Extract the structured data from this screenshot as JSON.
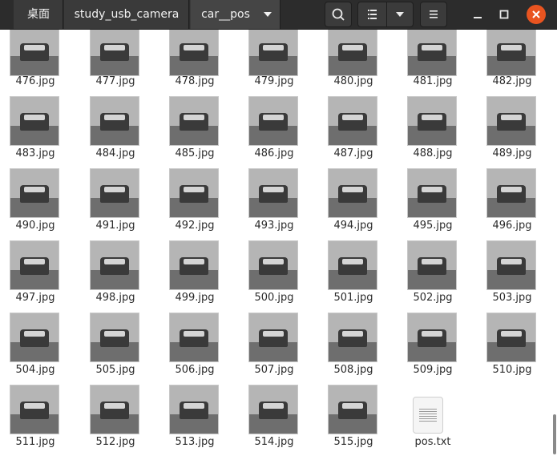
{
  "titlebar": {
    "breadcrumbs": [
      {
        "label": "桌面"
      },
      {
        "label": "study_usb_camera"
      },
      {
        "label": "car__pos"
      }
    ],
    "icons": {
      "search": "search-icon",
      "list_view": "list-view-icon",
      "view_dropdown": "chevron-down-icon",
      "menu": "hamburger-menu-icon",
      "minimize": "minimize-icon",
      "maximize": "maximize-icon",
      "close": "close-icon"
    },
    "colors": {
      "close": "#e95420",
      "bar": "#2c2c2c"
    }
  },
  "files": [
    "476.jpg",
    "477.jpg",
    "478.jpg",
    "479.jpg",
    "480.jpg",
    "481.jpg",
    "482.jpg",
    "483.jpg",
    "484.jpg",
    "485.jpg",
    "486.jpg",
    "487.jpg",
    "488.jpg",
    "489.jpg",
    "490.jpg",
    "491.jpg",
    "492.jpg",
    "493.jpg",
    "494.jpg",
    "495.jpg",
    "496.jpg",
    "497.jpg",
    "498.jpg",
    "499.jpg",
    "500.jpg",
    "501.jpg",
    "502.jpg",
    "503.jpg",
    "504.jpg",
    "505.jpg",
    "506.jpg",
    "507.jpg",
    "508.jpg",
    "509.jpg",
    "510.jpg",
    "511.jpg",
    "512.jpg",
    "513.jpg",
    "514.jpg",
    "515.jpg",
    "pos.txt"
  ]
}
